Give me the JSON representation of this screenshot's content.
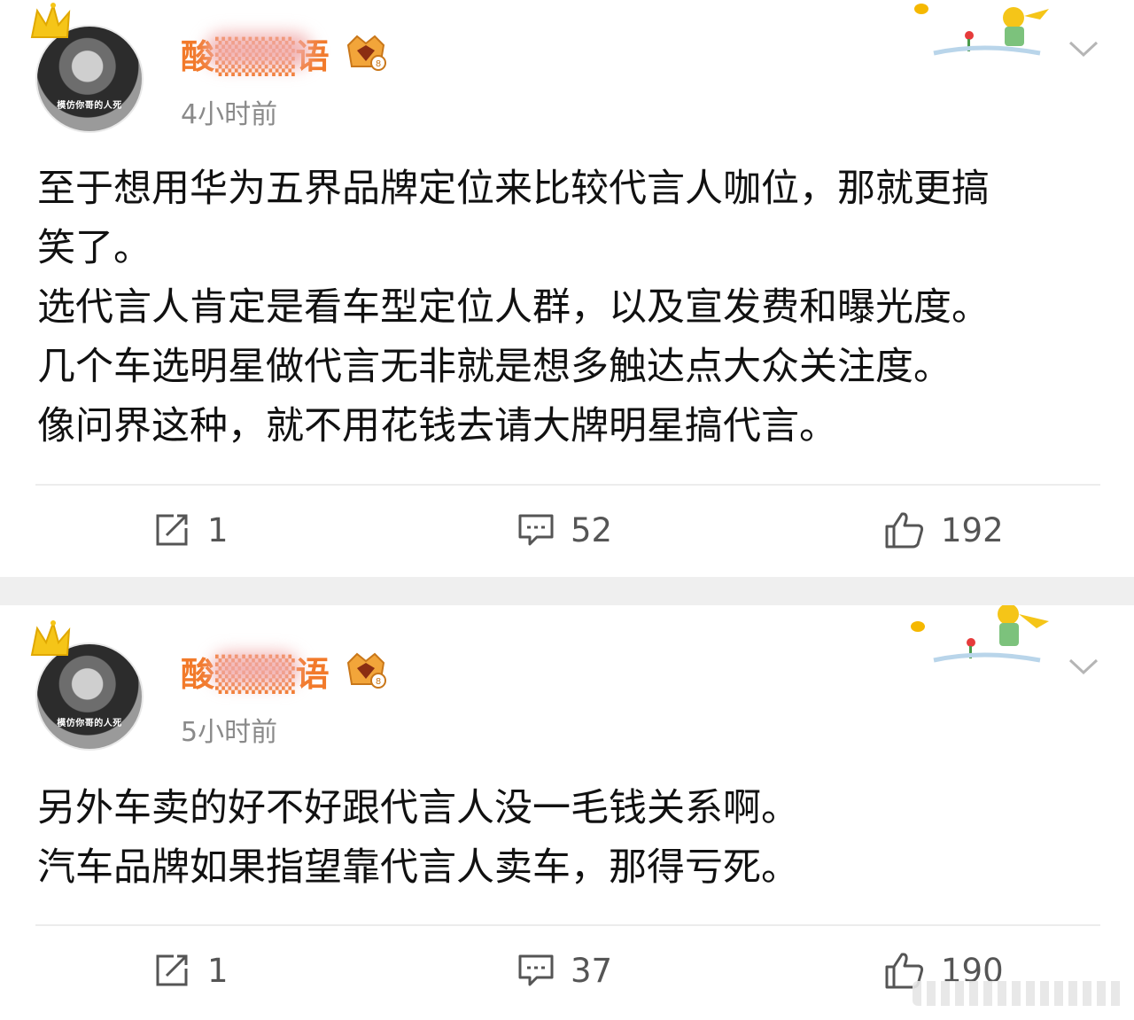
{
  "posts": [
    {
      "avatar_text": "模仿你哥的人死",
      "username": "酸▒▒▒语",
      "timestamp": "4小时前",
      "content": [
        "至于想用华为五界品牌定位来比较代言人咖位，那就更搞",
        "笑了。",
        "选代言人肯定是看车型定位人群，以及宣发费和曝光度。",
        "几个车选明星做代言无非就是想多触达点大众关注度。",
        "像问界这种，就不用花钱去请大牌明星搞代言。"
      ],
      "repost_count": "1",
      "comment_count": "52",
      "like_count": "192"
    },
    {
      "avatar_text": "模仿你哥的人死",
      "username": "酸▒▒▒语",
      "timestamp": "5小时前",
      "content": [
        "另外车卖的好不好跟代言人没一毛钱关系啊。",
        "汽车品牌如果指望靠代言人卖车，那得亏死。"
      ],
      "repost_count": "1",
      "comment_count": "37",
      "like_count": "190"
    }
  ],
  "colors": {
    "username": "#f27a2a",
    "timestamp": "#8a8a8a",
    "action_text": "#555555",
    "separator": "#efefef"
  },
  "icons": {
    "repost": "repost-icon",
    "comment": "comment-icon",
    "like": "thumbs-up-icon",
    "more": "chevron-down-icon",
    "crown": "crown-icon",
    "vip": "vip-badge-icon"
  }
}
